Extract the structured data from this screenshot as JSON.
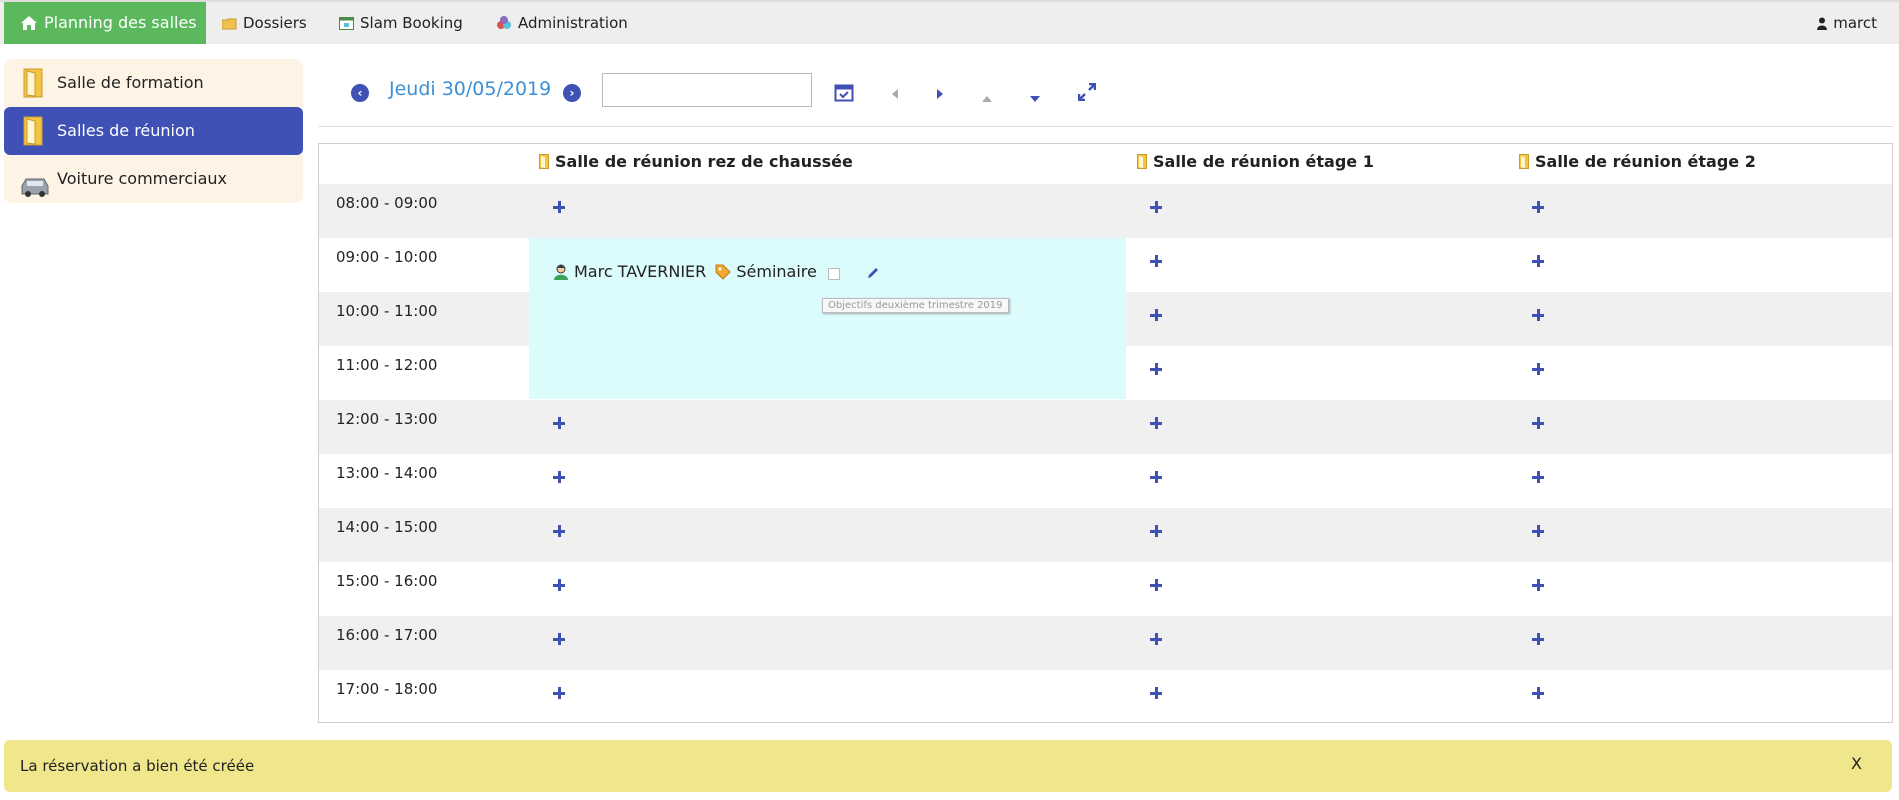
{
  "topnav": {
    "home_label": "Planning des salles",
    "items": [
      "Dossiers",
      "Slam Booking",
      "Administration"
    ],
    "user": "marct"
  },
  "sidebar": {
    "items": [
      {
        "label": "Salle de formation",
        "icon": "door-icon"
      },
      {
        "label": "Salles de réunion",
        "icon": "door-icon",
        "selected": true
      },
      {
        "label": "Voiture commerciaux",
        "icon": "car-icon"
      }
    ]
  },
  "datebar": {
    "date": "Jeudi 30/05/2019",
    "input_value": ""
  },
  "grid": {
    "columns": [
      "Salle de réunion rez de chaussée",
      "Salle de réunion étage 1",
      "Salle de réunion étage 2"
    ],
    "times": [
      "08:00 - 09:00",
      "09:00 - 10:00",
      "10:00 - 11:00",
      "11:00 - 12:00",
      "12:00 - 13:00",
      "13:00 - 14:00",
      "14:00 - 15:00",
      "15:00 - 16:00",
      "16:00 - 17:00",
      "17:00 - 18:00"
    ]
  },
  "booking": {
    "person": "Marc TAVERNIER",
    "category": "Séminaire",
    "tooltip": "Objectifs deuxième trimestre 2019"
  },
  "notification": {
    "message": "La réservation a bien été créée",
    "close": "X"
  },
  "colors": {
    "accent": "#3f51b5",
    "home_green": "#5cb85c",
    "booking_bg": "#dcfbfd",
    "notification_bg": "#f0e68c",
    "date_blue": "#3d8fd6"
  }
}
